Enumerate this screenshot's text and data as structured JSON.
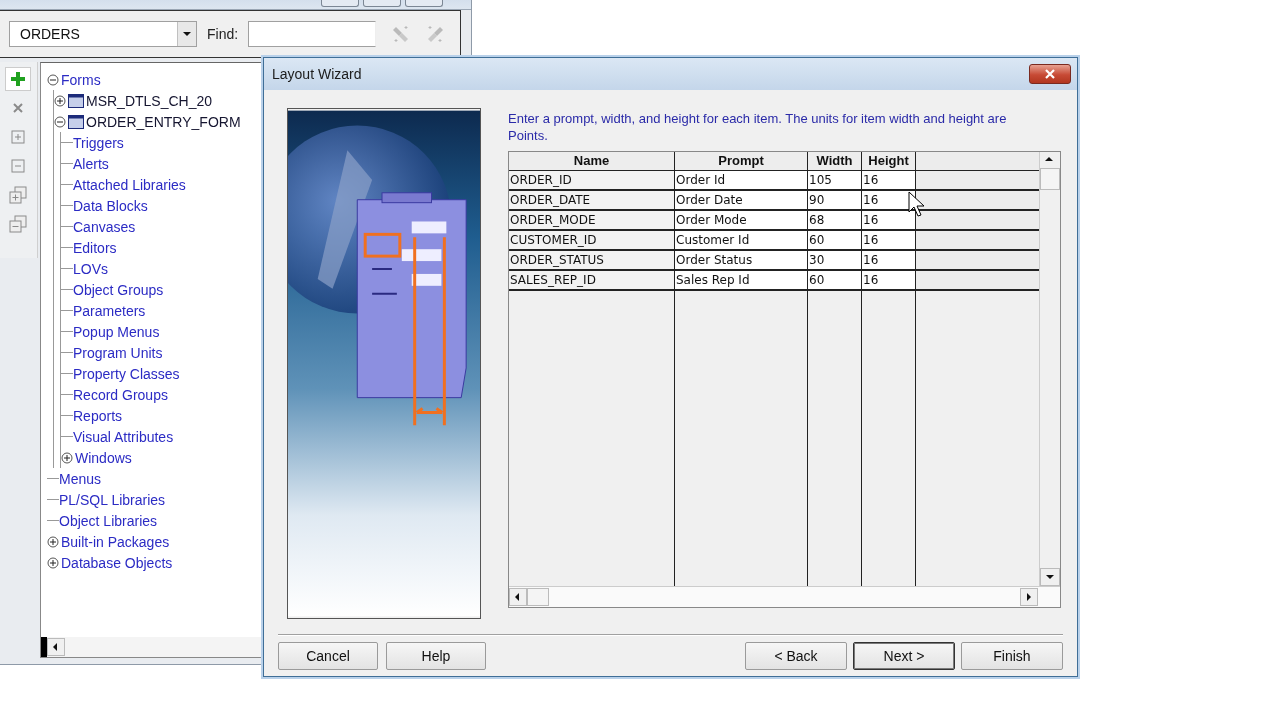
{
  "navigator": {
    "module_select": {
      "value": "ORDERS"
    },
    "find": {
      "label": "Find:"
    },
    "find_tools": [
      {
        "kind": "find_next",
        "disabled": true
      },
      {
        "kind": "find_previous",
        "disabled": true
      }
    ],
    "side_tools": [
      {
        "kind": "create",
        "disabled": false
      },
      {
        "kind": "delete",
        "disabled": true
      },
      {
        "kind": "expand",
        "disabled": true
      },
      {
        "kind": "collapse",
        "disabled": true
      },
      {
        "kind": "expand_all",
        "disabled": true
      },
      {
        "kind": "collapse_all",
        "disabled": true
      }
    ],
    "tree": [
      {
        "label": "Forms",
        "kind": "branch",
        "expanded": true,
        "children": [
          {
            "label": "MSR_DTLS_CH_20",
            "kind": "module",
            "expanded": false
          },
          {
            "label": "ORDER_ENTRY_FORM",
            "kind": "module",
            "expanded": true,
            "children": [
              {
                "label": "Triggers",
                "kind": "leaf"
              },
              {
                "label": "Alerts",
                "kind": "leaf"
              },
              {
                "label": "Attached Libraries",
                "kind": "leaf"
              },
              {
                "label": "Data Blocks",
                "kind": "leaf"
              },
              {
                "label": "Canvases",
                "kind": "leaf"
              },
              {
                "label": "Editors",
                "kind": "leaf"
              },
              {
                "label": "LOVs",
                "kind": "leaf"
              },
              {
                "label": "Object Groups",
                "kind": "leaf"
              },
              {
                "label": "Parameters",
                "kind": "leaf"
              },
              {
                "label": "Popup Menus",
                "kind": "leaf"
              },
              {
                "label": "Program Units",
                "kind": "leaf"
              },
              {
                "label": "Property Classes",
                "kind": "leaf"
              },
              {
                "label": "Record Groups",
                "kind": "leaf"
              },
              {
                "label": "Reports",
                "kind": "leaf"
              },
              {
                "label": "Visual Attributes",
                "kind": "leaf"
              },
              {
                "label": "Windows",
                "kind": "branch",
                "expanded": false
              }
            ]
          }
        ]
      },
      {
        "label": "Menus",
        "kind": "leaf"
      },
      {
        "label": "PL/SQL Libraries",
        "kind": "leaf"
      },
      {
        "label": "Object Libraries",
        "kind": "leaf"
      },
      {
        "label": "Built-in Packages",
        "kind": "branch",
        "expanded": false
      },
      {
        "label": "Database Objects",
        "kind": "branch",
        "expanded": false
      }
    ]
  },
  "wizard": {
    "title": "Layout Wizard",
    "instructions": "Enter a prompt, width, and height for each item. The units for item width and height are Points.",
    "table": {
      "columns": [
        "Name",
        "Prompt",
        "Width",
        "Height"
      ],
      "rows": [
        [
          "ORDER_ID",
          "Order Id",
          "105",
          "16"
        ],
        [
          "ORDER_DATE",
          "Order Date",
          "90",
          "16"
        ],
        [
          "ORDER_MODE",
          "Order Mode",
          "68",
          "16"
        ],
        [
          "CUSTOMER_ID",
          "Customer Id",
          "60",
          "16"
        ],
        [
          "ORDER_STATUS",
          "Order Status",
          "30",
          "16"
        ],
        [
          "SALES_REP_ID",
          "Sales Rep Id",
          "60",
          "16"
        ]
      ]
    },
    "buttons_left": [
      {
        "label": "Cancel",
        "default": false
      },
      {
        "label": "Help",
        "default": false
      }
    ],
    "buttons_right": [
      {
        "label": "< Back",
        "default": false
      },
      {
        "label": "Next >",
        "default": true
      },
      {
        "label": "Finish",
        "default": false
      }
    ]
  }
}
